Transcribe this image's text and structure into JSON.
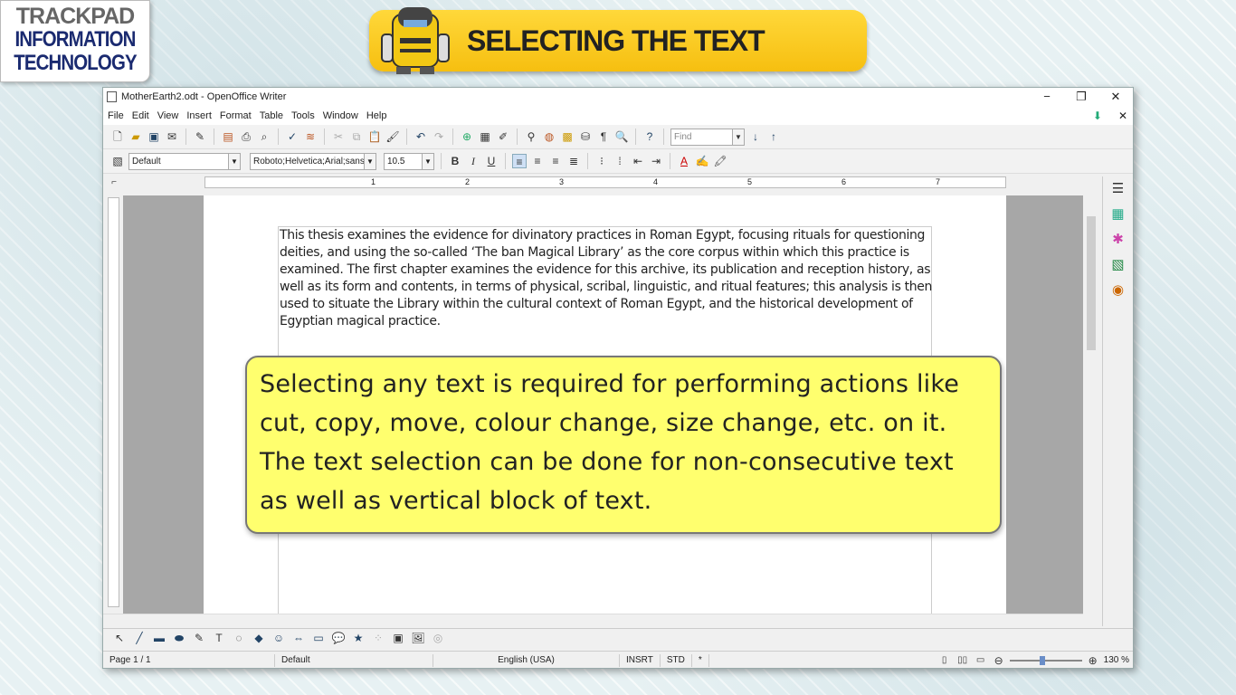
{
  "branding": {
    "line1": "TRACKPAD",
    "line2": "INFORMATION",
    "line3": "TECHNOLOGY"
  },
  "banner": {
    "title": "SELECTING THE TEXT"
  },
  "window": {
    "title": "MotherEarth2.odt - OpenOffice Writer",
    "minimize": "−",
    "maximize": "❐",
    "close": "✕"
  },
  "menu": {
    "items": [
      "File",
      "Edit",
      "View",
      "Insert",
      "Format",
      "Table",
      "Tools",
      "Window",
      "Help"
    ],
    "close_doc": "✕",
    "update": "⬇"
  },
  "toolbar": {
    "find_placeholder": "Find"
  },
  "formatbar": {
    "style": "Default",
    "font": "Roboto;Helvetica;Arial;sans",
    "size": "10.5",
    "bold": "B",
    "italic": "I",
    "underline": "U"
  },
  "ruler": {
    "numbers": [
      "1",
      "2",
      "3",
      "4",
      "5",
      "6",
      "7"
    ]
  },
  "document": {
    "paragraph": "This thesis examines the evidence for divinatory practices in Roman Egypt, focusing rituals for questioning deities, and using the so-called ‘The ban Magical Library’ as the core corpus within which this practice is examined. The first chapter examines the evidence for this archive, its publication and reception history, as well as its form and contents, in terms of physical, scribal, linguistic, and ritual features; this analysis is then used to situate the Library within the cultural context of Roman Egypt, and the historical development of Egyptian magical practice."
  },
  "status": {
    "page": "Page 1 / 1",
    "style": "Default",
    "language": "English (USA)",
    "insert": "INSRT",
    "select": "STD",
    "modified": "*",
    "zoom": "130 %",
    "zoom_level": 0.45
  },
  "callout": {
    "text": "Selecting any text is required for performing actions like cut, copy, move, colour change, size change, etc. on it. The text selection can be done for non-consecutive text as well as vertical block of text."
  }
}
